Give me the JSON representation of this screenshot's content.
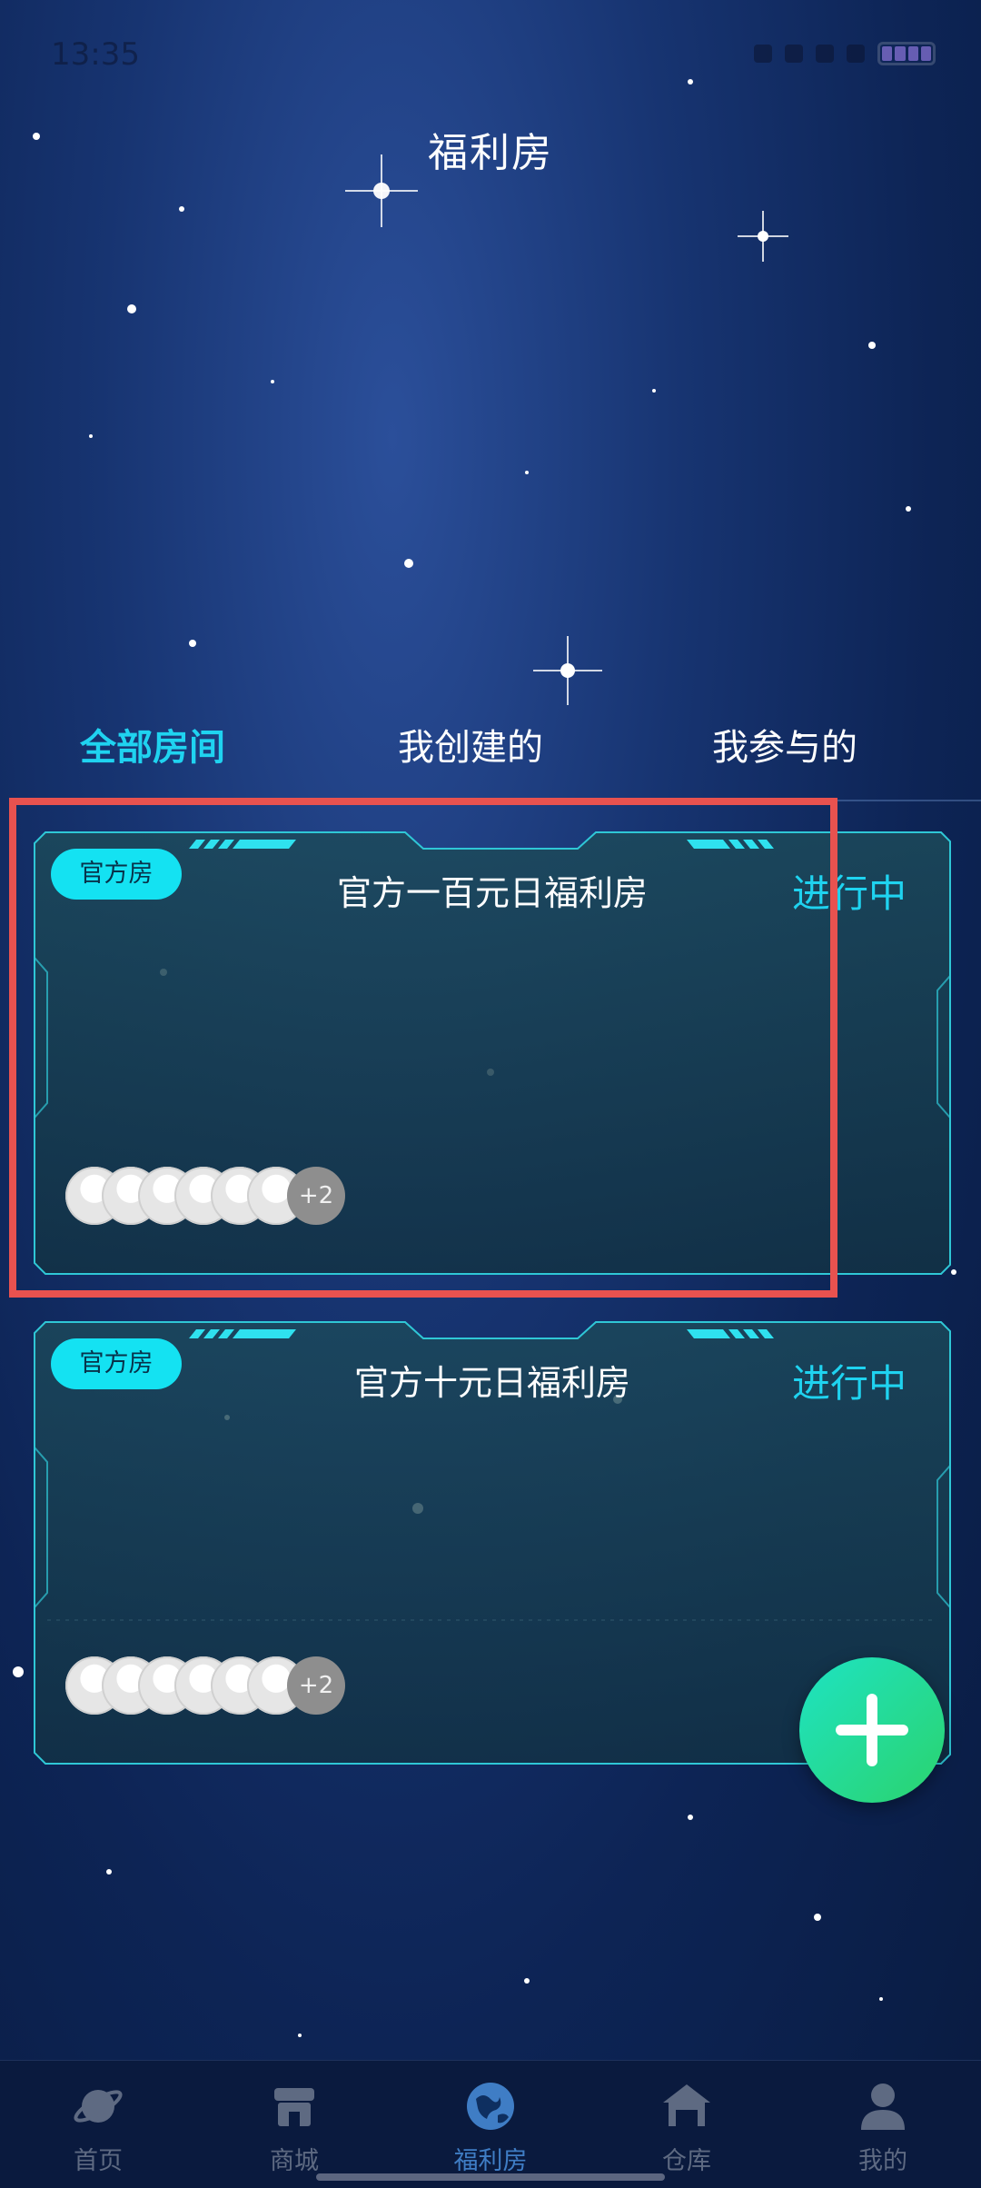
{
  "status_bar": {
    "time": "13:35"
  },
  "page": {
    "title": "福利房"
  },
  "tabs": [
    {
      "label": "全部房间",
      "active": true
    },
    {
      "label": "我创建的",
      "active": false
    },
    {
      "label": "我参与的",
      "active": false
    }
  ],
  "rooms": [
    {
      "badge": "官方房",
      "title": "官方一百元日福利房",
      "status": "进行中",
      "more_participants": "+2"
    },
    {
      "badge": "官方房",
      "title": "官方十元日福利房",
      "status": "进行中",
      "more_participants": "+2"
    }
  ],
  "fab": {
    "icon": "plus-icon"
  },
  "bottom_nav": [
    {
      "label": "首页",
      "icon": "planet-icon"
    },
    {
      "label": "商城",
      "icon": "shop-icon"
    },
    {
      "label": "福利房",
      "icon": "globe-icon",
      "active": true
    },
    {
      "label": "仓库",
      "icon": "warehouse-icon"
    },
    {
      "label": "我的",
      "icon": "user-icon"
    }
  ],
  "colors": {
    "accent": "#1fd3f0",
    "badge": "#14e2f2",
    "fab_start": "#1ee3c3",
    "fab_end": "#2bd36d",
    "highlight_border": "#e8524f"
  }
}
